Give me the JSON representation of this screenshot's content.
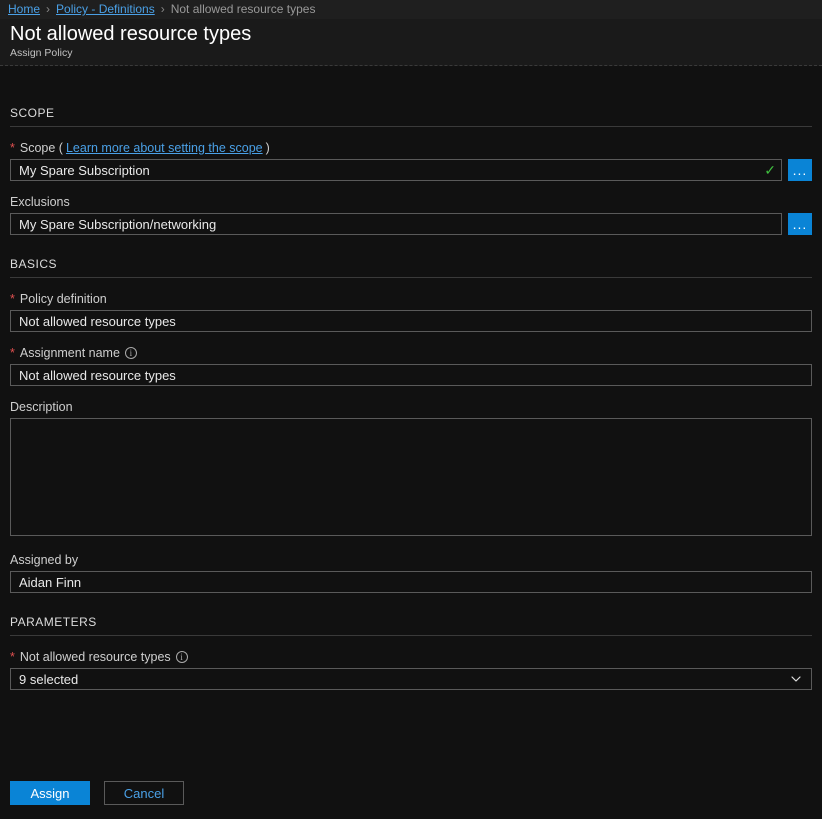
{
  "breadcrumb": {
    "home": "Home",
    "policy": "Policy - Definitions",
    "current": "Not allowed resource types"
  },
  "header": {
    "title": "Not allowed resource types",
    "subtitle": "Assign Policy"
  },
  "sections": {
    "scope": "SCOPE",
    "basics": "BASICS",
    "parameters": "PARAMETERS"
  },
  "scope": {
    "label_prefix": "Scope (",
    "learn_link": "Learn more about setting the scope",
    "label_suffix": ")",
    "value": "My Spare Subscription",
    "exclusions_label": "Exclusions",
    "exclusions_value": "My Spare Subscription/networking"
  },
  "basics": {
    "policy_def_label": "Policy definition",
    "policy_def_value": "Not allowed resource types",
    "assignment_label": "Assignment name",
    "assignment_value": "Not allowed resource types",
    "description_label": "Description",
    "description_value": "",
    "assigned_by_label": "Assigned by",
    "assigned_by_value": "Aidan Finn"
  },
  "parameters": {
    "not_allowed_label": "Not allowed resource types",
    "not_allowed_value": "9 selected"
  },
  "actions": {
    "assign": "Assign",
    "cancel": "Cancel"
  },
  "icons": {
    "ellipsis": "...",
    "check": "✓",
    "info": "i"
  }
}
